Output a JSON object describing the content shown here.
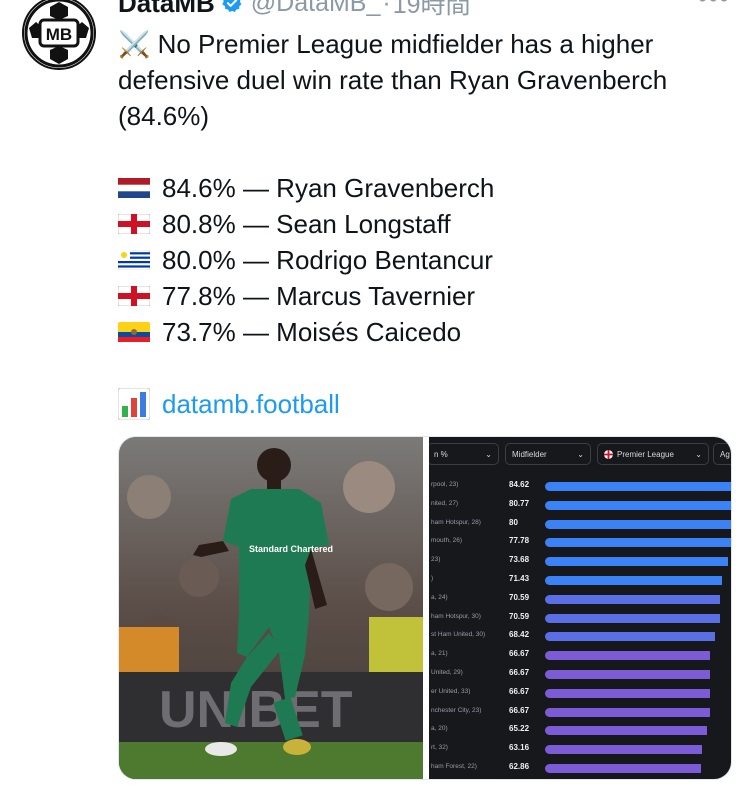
{
  "header": {
    "name": "DataMB",
    "handle": "@DataMB_",
    "separator": "·",
    "time": "19時間"
  },
  "avatar": {
    "text": "MB"
  },
  "tweet": {
    "intro": "⚔️ No Premier League midfielder has a higher defensive duel win rate than Ryan Gravenberch (84.6%)",
    "list": [
      {
        "flag": "netherlands",
        "text": "84.6% — Ryan Gravenberch"
      },
      {
        "flag": "england",
        "text": "80.8% — Sean Longstaff"
      },
      {
        "flag": "uruguay",
        "text": "80.0% — Rodrigo Bentancur"
      },
      {
        "flag": "england",
        "text": "77.8% — Marcus Tavernier"
      },
      {
        "flag": "ecuador",
        "text": "73.7% — Moisés Caicedo"
      }
    ],
    "link_icon": "bar-chart-emoji",
    "link_text": "datamb.football"
  },
  "media": {
    "photo": {
      "shirt_text": "Standard Chartered",
      "banner_text": "UNIBET"
    },
    "table": {
      "filters": [
        {
          "label": "n %"
        },
        {
          "label": "Midfielder"
        },
        {
          "label": "Premier League"
        },
        {
          "label": "Ag"
        }
      ],
      "rows": [
        {
          "name": "rpool, 23)",
          "value": "84.62"
        },
        {
          "name": "nited, 27)",
          "value": "80.77"
        },
        {
          "name": "ham Hotspur, 28)",
          "value": "80"
        },
        {
          "name": "mouth, 26)",
          "value": "77.78"
        },
        {
          "name": "23)",
          "value": "73.68"
        },
        {
          "name": ")",
          "value": "71.43"
        },
        {
          "name": "a, 24)",
          "value": "70.59"
        },
        {
          "name": "ham Hotspur, 30)",
          "value": "70.59"
        },
        {
          "name": "st Ham United, 30)",
          "value": "68.42"
        },
        {
          "name": "a, 21)",
          "value": "66.67"
        },
        {
          "name": "United, 29)",
          "value": "66.67"
        },
        {
          "name": "er United, 33)",
          "value": "66.67"
        },
        {
          "name": "nchester City, 23)",
          "value": "66.67"
        },
        {
          "name": "a, 20)",
          "value": "65.22"
        },
        {
          "name": "rt, 32)",
          "value": "63.16"
        },
        {
          "name": "ham Forest, 22)",
          "value": "62.86"
        }
      ],
      "bar_color_top": "#3b82f6",
      "bar_color_bottom": "#7c5cd6"
    }
  }
}
